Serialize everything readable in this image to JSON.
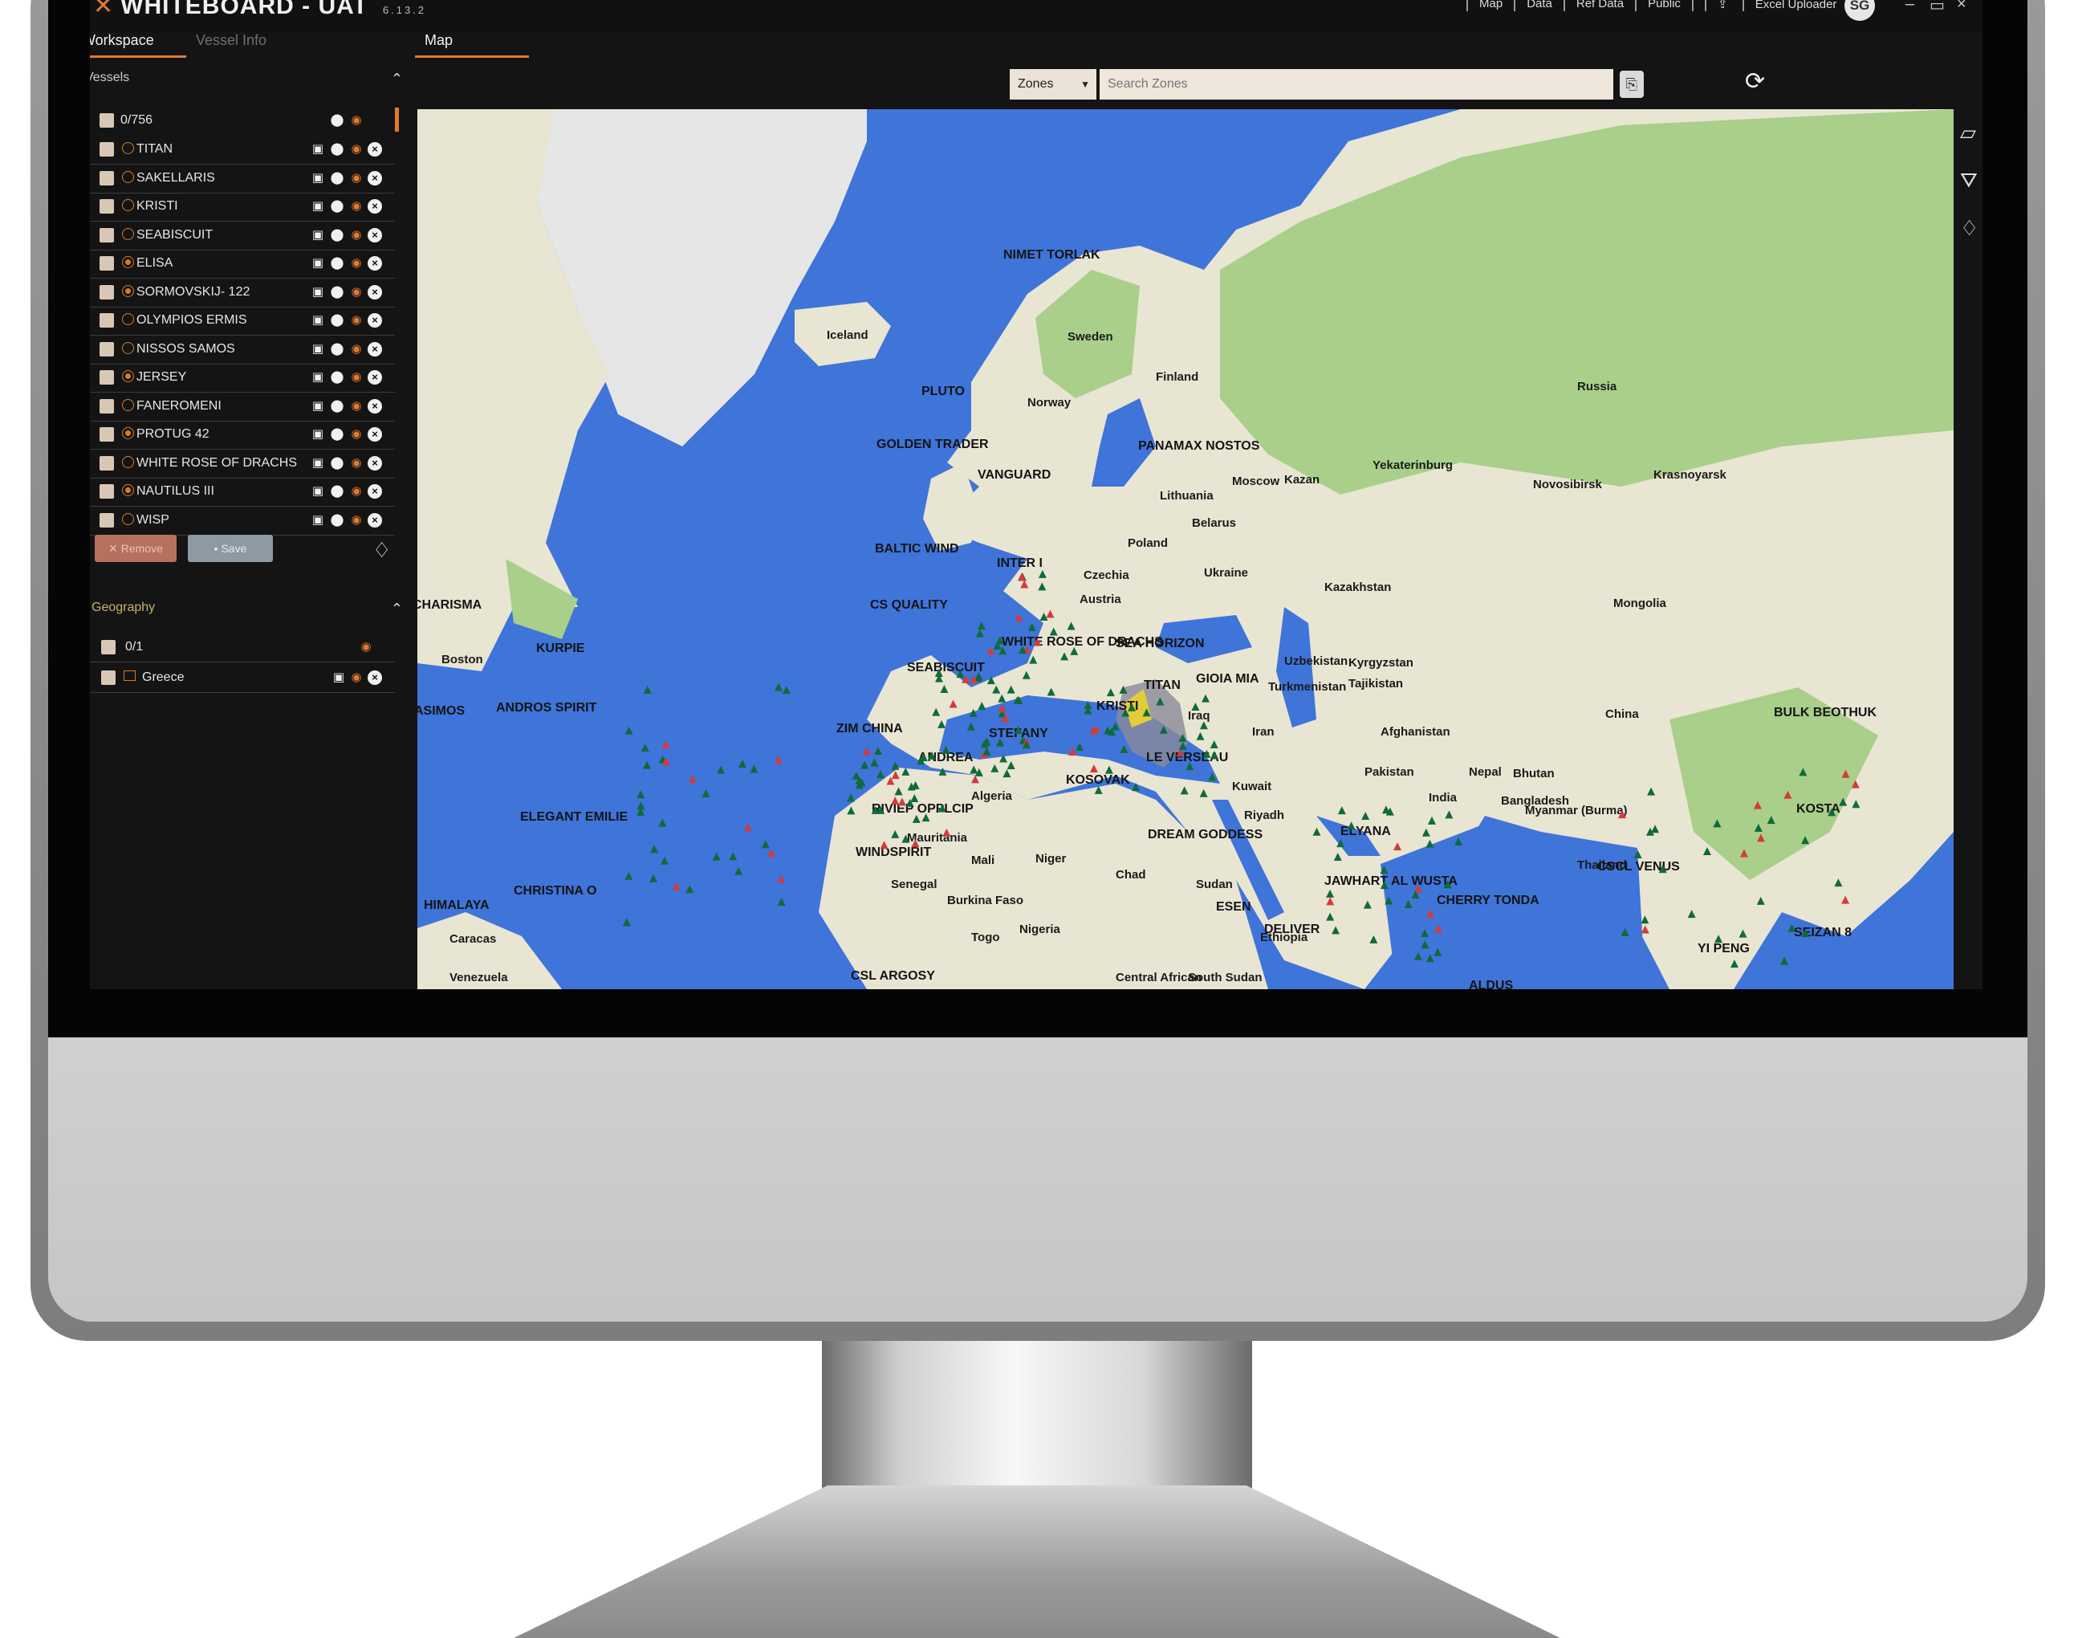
{
  "app": {
    "title": "WHITEBOARD - UAT",
    "version": "6.13.2",
    "nav": [
      "Map",
      "Data",
      "Ref Data",
      "Public",
      "Excel Uploader"
    ],
    "user_initials": "SG",
    "window_controls": [
      "minimize",
      "maximize",
      "close"
    ]
  },
  "left_tabs": [
    {
      "label": "Workspace",
      "active": true
    },
    {
      "label": "Vessel Info",
      "active": false
    }
  ],
  "map_tab": {
    "label": "Map"
  },
  "sidebar": {
    "vessels_heading": "Vessels",
    "vessels_count": "0/756",
    "vessels": [
      {
        "name": "TITAN",
        "status": "outline"
      },
      {
        "name": "SAKELLARIS",
        "status": "outline"
      },
      {
        "name": "KRISTI",
        "status": "outline"
      },
      {
        "name": "SEABISCUIT",
        "status": "outline"
      },
      {
        "name": "ELISA",
        "status": "filled"
      },
      {
        "name": "SORMOVSKIJ- 122",
        "status": "filled"
      },
      {
        "name": "OLYMPIOS ERMIS",
        "status": "outline"
      },
      {
        "name": "NISSOS SAMOS",
        "status": "outline"
      },
      {
        "name": "JERSEY",
        "status": "filled"
      },
      {
        "name": "FANEROMENI",
        "status": "outline"
      },
      {
        "name": "PROTUG 42",
        "status": "filled"
      },
      {
        "name": "WHITE ROSE OF DRACHS",
        "status": "outline"
      },
      {
        "name": "NAUTILUS III",
        "status": "filled"
      },
      {
        "name": "WISP",
        "status": "outline"
      }
    ],
    "remove_label": "Remove",
    "save_label": "Save",
    "geography_heading": "Geography",
    "geography_count": "0/1",
    "geography_items": [
      {
        "name": "Greece"
      }
    ]
  },
  "map_toolbar": {
    "zone_type": "Zones",
    "search_placeholder": "Search Zones"
  },
  "colors": {
    "accent": "#e07a30",
    "ocean": "#3f74d9",
    "land": "#e8e4d2",
    "forest": "#a9cf8a"
  },
  "map": {
    "place_labels": [
      "Iceland",
      "Norway",
      "Sweden",
      "Finland",
      "Russia",
      "Moscow",
      "Kazan",
      "Yekaterinburg",
      "Novosibirsk",
      "Krasnoyarsk",
      "Lithuania",
      "Belarus",
      "Poland",
      "Ukraine",
      "Czechia",
      "Austria",
      "Kazakhstan",
      "Mongolia",
      "Uzbekistan",
      "Kyrgyzstan",
      "Turkmenistan",
      "Tajikistan",
      "China",
      "Iran",
      "Iraq",
      "Afghanistan",
      "Pakistan",
      "Nepal",
      "Bhutan",
      "Bangladesh",
      "India",
      "Myanmar (Burma)",
      "Thailand",
      "Kuwait",
      "Riyadh",
      "Algeria",
      "Mauritania",
      "Mali",
      "Niger",
      "Chad",
      "Sudan",
      "Senegal",
      "Burkina Faso",
      "Nigeria",
      "Ethiopia",
      "Central African",
      "South Sudan",
      "Togo",
      "Boston",
      "Caracas",
      "Venezuela"
    ],
    "vessel_labels": [
      "NIMET TORLAK",
      "PLUTO",
      "GOLDEN TRADER",
      "VANGUARD",
      "PANAMAX NOSTOS",
      "BALTIC WIND",
      "INTER I",
      "CS QUALITY",
      "CHARISMA",
      "KURPIE",
      "SEABISCUIT",
      "WHITE ROSE OF DRACHS",
      "SEA HORIZON",
      "TITAN",
      "KRISTI",
      "GIOIA MIA",
      "ANDROS SPIRIT",
      "ASIMOS",
      "ZIM CHINA",
      "STEFANY",
      "ANDREA",
      "LE VERSEAU",
      "KOSOVAK",
      "RIVIEP OPPLCIP",
      "ELEGANT EMILIE",
      "WINDSPIRIT",
      "DREAM GODDESS",
      "ELYANA",
      "HIMALAYA",
      "CHRISTINA O",
      "JAWHART AL WUSTA",
      "ESEN",
      "DELIVER",
      "CHERRY TONDA",
      "CSCL VENUS",
      "SEIZAN 8",
      "YI PENG",
      "KOSTA",
      "BULK BEOTHUK",
      "CSL ARGOSY",
      "ALDUS"
    ]
  }
}
